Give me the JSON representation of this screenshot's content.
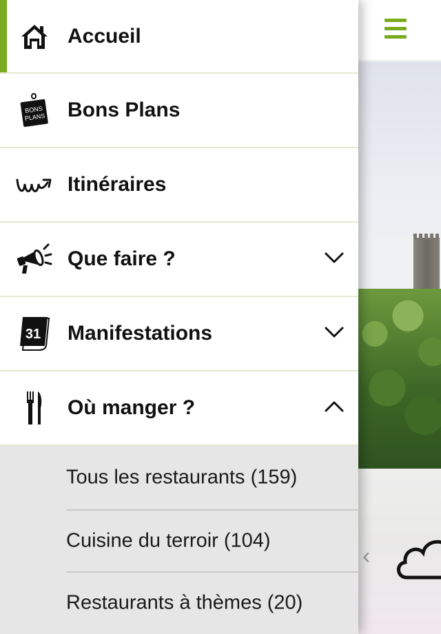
{
  "colors": {
    "accent": "#7aab1e",
    "divider": "#e4e8cf",
    "submenu_bg": "#e6e6e6",
    "text": "#111111"
  },
  "header": {
    "menu_icon": "hamburger-icon"
  },
  "menu": {
    "items": [
      {
        "label": "Accueil",
        "icon": "home-icon",
        "active": true
      },
      {
        "label": "Bons Plans",
        "icon": "bons-plans-tag-icon",
        "icon_text_1": "BONS",
        "icon_text_2": "PLANS"
      },
      {
        "label": "Itinéraires",
        "icon": "route-icon"
      },
      {
        "label": "Que faire ?",
        "icon": "megaphone-icon",
        "expandable": "collapsed"
      },
      {
        "label": "Manifestations",
        "icon": "calendar-icon",
        "icon_text": "31",
        "expandable": "collapsed"
      },
      {
        "label": "Où manger ?",
        "icon": "cutlery-icon",
        "expandable": "expanded"
      }
    ],
    "submenu": [
      {
        "label": "Tous les restaurants (159)"
      },
      {
        "label": "Cuisine du terroir (104)"
      },
      {
        "label": "Restaurants à thèmes (20)"
      }
    ]
  },
  "background": {
    "prev_arrow": "‹",
    "weather_icon": "cloud-icon"
  }
}
